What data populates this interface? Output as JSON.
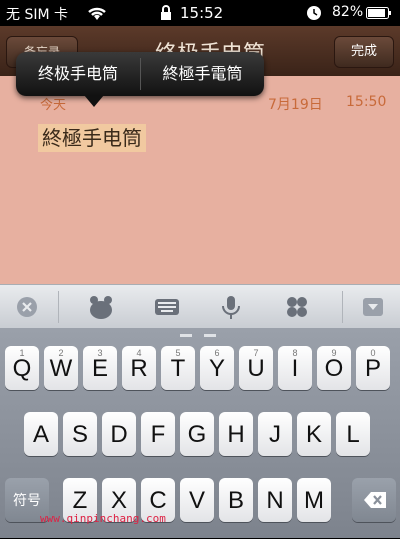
{
  "status_bar": {
    "carrier": "无 SIM 卡",
    "time": "15:52",
    "battery_pct": "82%"
  },
  "nav": {
    "back_label": "备忘录",
    "title": "终极手电筒",
    "done_label": "完成"
  },
  "popup": {
    "options": [
      "终极手电筒",
      "終極手電筒"
    ]
  },
  "note": {
    "day": "今天",
    "date": "7月19日",
    "time": "15:50",
    "text": "終極手电筒"
  },
  "keyboard": {
    "row1": [
      {
        "k": "Q",
        "n": "1"
      },
      {
        "k": "W",
        "n": "2"
      },
      {
        "k": "E",
        "n": "3"
      },
      {
        "k": "R",
        "n": "4"
      },
      {
        "k": "T",
        "n": "5"
      },
      {
        "k": "Y",
        "n": "6"
      },
      {
        "k": "U",
        "n": "7"
      },
      {
        "k": "I",
        "n": "8"
      },
      {
        "k": "O",
        "n": "9"
      },
      {
        "k": "P",
        "n": "0"
      }
    ],
    "row2": [
      "A",
      "S",
      "D",
      "F",
      "G",
      "H",
      "J",
      "K",
      "L"
    ],
    "row3": [
      "Z",
      "X",
      "C",
      "V",
      "B",
      "N",
      "M"
    ],
    "symbol_key": "符号"
  },
  "watermark": "www.qinpinchang.com",
  "colors": {
    "nav_bg": "#4a2e20",
    "pad_bg": "#fdf3a8",
    "accent_date": "#c86a3a",
    "highlight": "#f1c9a0"
  }
}
